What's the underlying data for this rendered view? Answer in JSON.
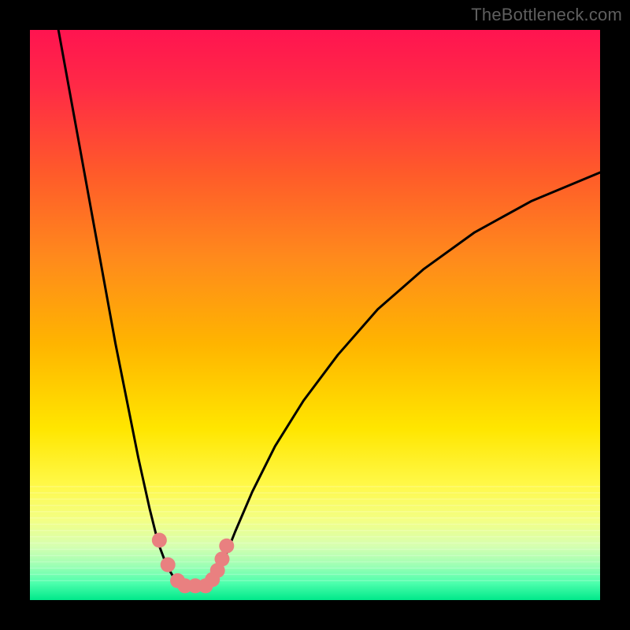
{
  "attribution": "TheBottleneck.com",
  "chart_data": {
    "type": "line",
    "title": "",
    "xlabel": "",
    "ylabel": "",
    "xlim": [
      0,
      100
    ],
    "ylim": [
      0,
      100
    ],
    "series": [
      {
        "name": "curve-left",
        "x": [
          5,
          7,
          9,
          11,
          13,
          15,
          17,
          19,
          21,
          22.5,
          24,
          25.5,
          27
        ],
        "y": [
          100,
          89,
          78,
          67,
          56,
          45,
          35,
          25,
          16,
          10,
          6,
          3.5,
          2.5
        ]
      },
      {
        "name": "curve-right",
        "x": [
          31,
          32.5,
          34,
          36,
          39,
          43,
          48,
          54,
          61,
          69,
          78,
          88,
          100
        ],
        "y": [
          2.5,
          4,
          7,
          12,
          19,
          27,
          35,
          43,
          51,
          58,
          64.5,
          70,
          75
        ]
      }
    ],
    "floor_segment": {
      "x": [
        27,
        31
      ],
      "y": 2.5
    },
    "markers": [
      {
        "x": 22.7,
        "y": 10.5
      },
      {
        "x": 24.2,
        "y": 6.2
      },
      {
        "x": 25.9,
        "y": 3.4
      },
      {
        "x": 27.2,
        "y": 2.5
      },
      {
        "x": 29.0,
        "y": 2.5
      },
      {
        "x": 30.8,
        "y": 2.5
      },
      {
        "x": 32.0,
        "y": 3.6
      },
      {
        "x": 32.9,
        "y": 5.2
      },
      {
        "x": 33.7,
        "y": 7.2
      },
      {
        "x": 34.5,
        "y": 9.5
      }
    ],
    "gradient_stops": [
      {
        "offset": 0.0,
        "color": "#ff1450"
      },
      {
        "offset": 0.1,
        "color": "#ff2a46"
      },
      {
        "offset": 0.25,
        "color": "#ff5a2a"
      },
      {
        "offset": 0.4,
        "color": "#ff8a1c"
      },
      {
        "offset": 0.55,
        "color": "#ffb400"
      },
      {
        "offset": 0.7,
        "color": "#ffe600"
      },
      {
        "offset": 0.8,
        "color": "#fff94a"
      },
      {
        "offset": 0.86,
        "color": "#f3ff85"
      },
      {
        "offset": 0.905,
        "color": "#d6ffb0"
      },
      {
        "offset": 0.94,
        "color": "#9cffb4"
      },
      {
        "offset": 0.97,
        "color": "#4dffad"
      },
      {
        "offset": 1.0,
        "color": "#00e88a"
      }
    ],
    "marker_color": "#e98080",
    "curve_color": "#000000"
  }
}
